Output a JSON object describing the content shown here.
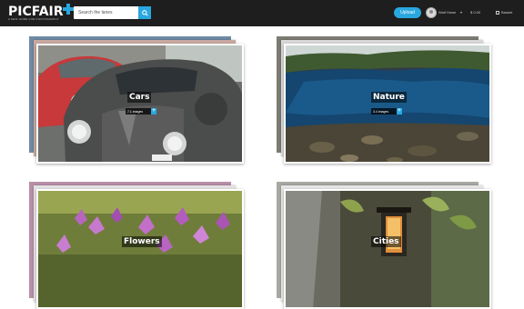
{
  "header": {
    "logo": "PICFAIR",
    "tagline": "A NEW HOME FOR PHOTOGRAPHY",
    "search_placeholder": "Search the lanes",
    "upload_label": "Upload",
    "user_name": "Walt Howe",
    "cart_count": "$ 0.00 ",
    "basket_label": "Basket"
  },
  "categories": [
    {
      "label": "Cars",
      "count": "7.1 images",
      "icon": "plus-icon"
    },
    {
      "label": "Nature",
      "count": "3.4 images",
      "icon": "plus-icon"
    },
    {
      "label": "Flowers",
      "count": "",
      "icon": "plus-icon"
    },
    {
      "label": "Cities",
      "count": "",
      "icon": "plus-icon"
    }
  ],
  "colors": {
    "accent": "#29a8e0",
    "topbar": "#1e1e1e"
  }
}
